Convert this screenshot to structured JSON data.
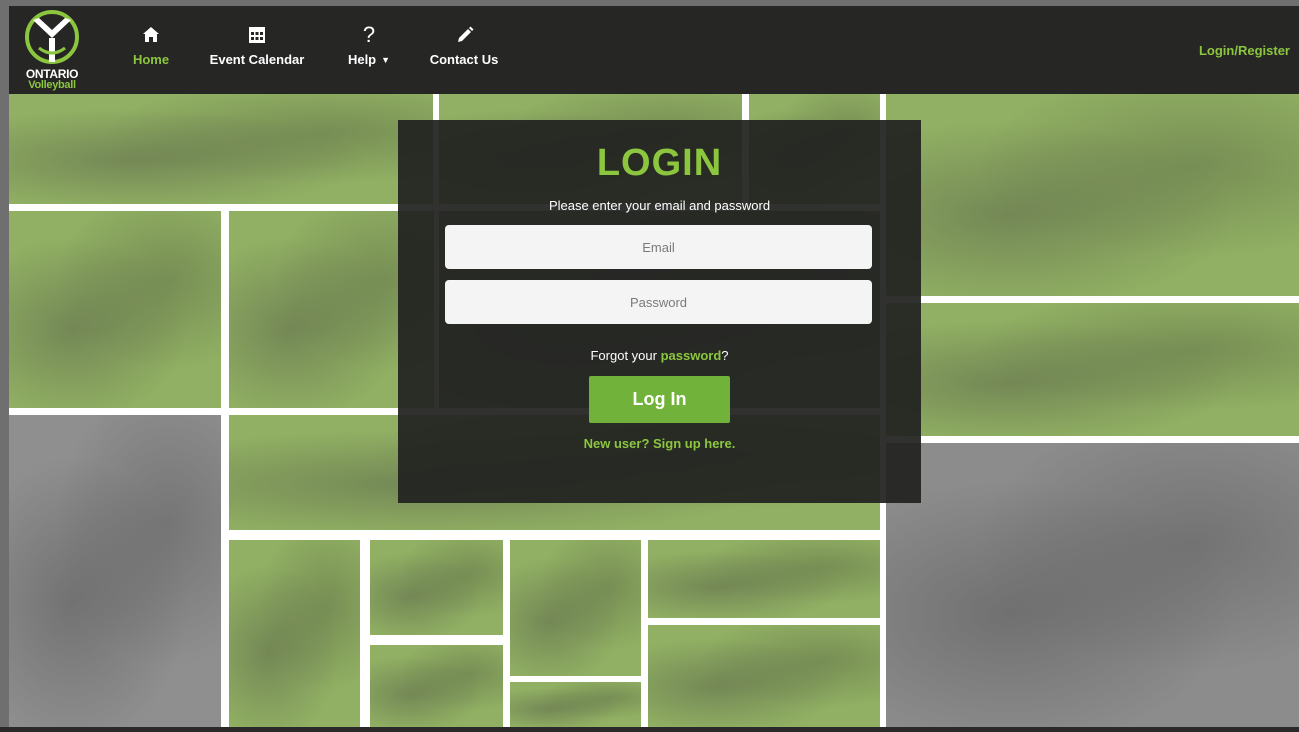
{
  "brand": {
    "line1": "ONTARIO",
    "line2": "Volleyball",
    "logo_icon": "ontario-volleyball-logo"
  },
  "nav": {
    "items": [
      {
        "label": "Home",
        "icon": "home-icon",
        "active": true
      },
      {
        "label": "Event Calendar",
        "icon": "calendar-icon",
        "active": false
      },
      {
        "label": "Help",
        "icon": "question-icon",
        "active": false,
        "dropdown": true
      },
      {
        "label": "Contact Us",
        "icon": "pencil-icon",
        "active": false
      }
    ],
    "login_register": "Login/Register"
  },
  "login": {
    "title": "LOGIN",
    "subtitle": "Please enter your email and password",
    "email_placeholder": "Email",
    "password_placeholder": "Password",
    "forgot_prefix": "Forgot your ",
    "forgot_link": "password",
    "forgot_suffix": "?",
    "button": "Log In",
    "signup": "New user? Sign up here."
  },
  "colors": {
    "accent": "#8cc63f",
    "nav_bg": "#262725",
    "panel_bg": "#212220",
    "button": "#71b33a"
  }
}
